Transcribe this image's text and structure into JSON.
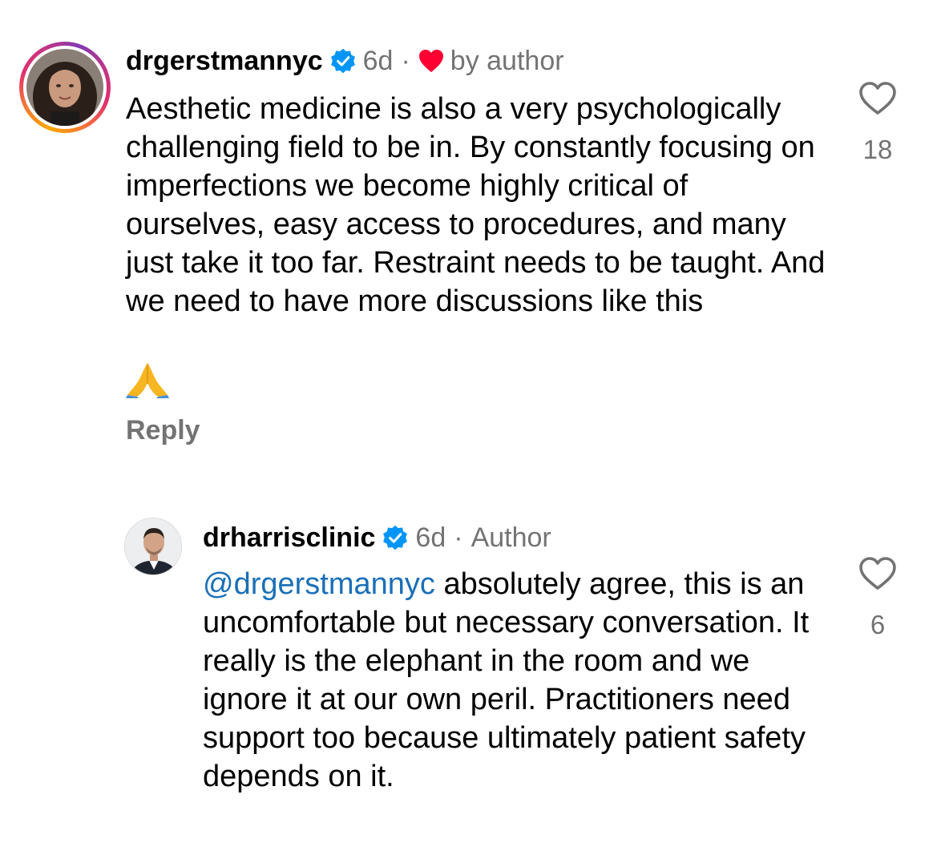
{
  "comments": [
    {
      "username": "drgerstmannyc",
      "time": "6d",
      "separator": "·",
      "liked_by_author_label": "by author",
      "text": "Aesthetic medicine is also a very psychologically challenging field to be in. By constantly focusing on imperfections we become highly critical of ourselves, easy access to procedures, and many just take it too far. Restraint needs to be taught. And we need to have more discussions like this",
      "emoji_icon": "folded-hands-emoji",
      "reply_label": "Reply",
      "like_count": "18"
    },
    {
      "username": "drharrisclinic",
      "time": "6d",
      "separator": "·",
      "author_label": "Author",
      "mention": "@drgerstmannyc",
      "text": " absolutely agree, this is an uncomfortable but necessary conversation. It really is the elephant in the room and we ignore it at our own peril. Practitioners need support too because ultimately patient safety depends on it.",
      "like_count": "6"
    }
  ],
  "colors": {
    "secondary_text": "#737373",
    "mention": "#1a6fb7",
    "verified": "#0095f6",
    "heart_red": "#ff0033"
  }
}
